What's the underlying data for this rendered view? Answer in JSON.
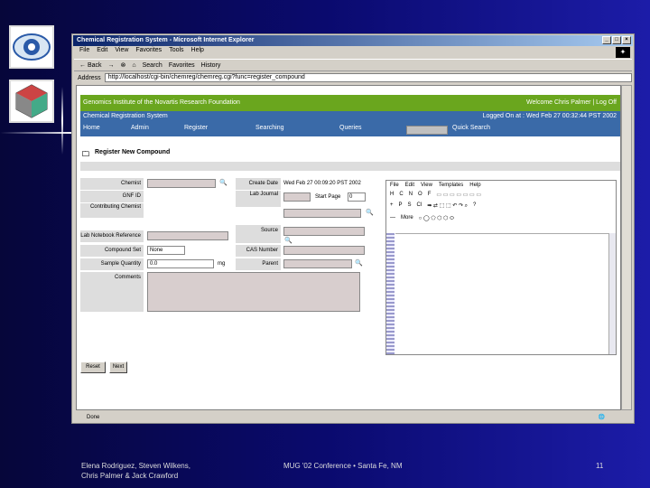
{
  "window": {
    "title": "Chemical Registration System - Microsoft Internet Explorer",
    "controls": [
      "_",
      "□",
      "×"
    ]
  },
  "menubar": [
    "File",
    "Edit",
    "View",
    "Favorites",
    "Tools",
    "Help"
  ],
  "toolbar": [
    "← Back",
    "→",
    "⊗",
    "⌂",
    "Search",
    "Favorites",
    "History"
  ],
  "address": {
    "label": "Address",
    "value": "http://localhost/cgi-bin/chemreg/chemreg.cgi?func=register_compound"
  },
  "app": {
    "org": "Genomics Institute of the Novartis Research Foundation",
    "welcome": "Welcome Chris Palmer  |  Log Off",
    "system": "Chemical Registration System",
    "login": "Logged On at : Wed Feb 27 00:32:44 PST 2002",
    "nav": [
      "Home",
      "Admin",
      "Register",
      "Searching",
      "Queries"
    ],
    "quick_search": "Quick Search",
    "page_title": "Register New Compound"
  },
  "form": {
    "chemist": "Chemist",
    "gnf_id": "GNF ID",
    "contributing_chemist": "Contributing Chemist",
    "lab_notebook_ref": "Lab Notebook Reference",
    "compound_set": "Compound Set",
    "compound_set_value": "None",
    "sample_quantity": "Sample Quantity",
    "sample_quantity_value": "0.0",
    "unit": "mg",
    "comments": "Comments",
    "create_date": "Create Date",
    "create_date_value": "Wed Feb 27 00:09:20 PST 2002",
    "lab_journal": "Lab Journal",
    "start_page": "Start Page",
    "start_page_value": "0",
    "source": "Source",
    "cas_number": "CAS Number",
    "parent": "Parent",
    "reset": "Reset",
    "next": "Next"
  },
  "editor": {
    "menu": [
      "File",
      "Edit",
      "View",
      "Templates",
      "Help"
    ],
    "atoms1": [
      "H",
      "C",
      "N",
      "O",
      "F"
    ],
    "atoms2": [
      "+",
      "P",
      "S",
      "Cl"
    ],
    "more": "More"
  },
  "status": "Done",
  "footer": {
    "authors_line1": "Elena Rodriguez, Steven Wilkens,",
    "authors_line2": "Chris Palmer & Jack Crawford",
    "conference": "MUG '02 Conference • Santa Fe, NM",
    "page": "11"
  }
}
